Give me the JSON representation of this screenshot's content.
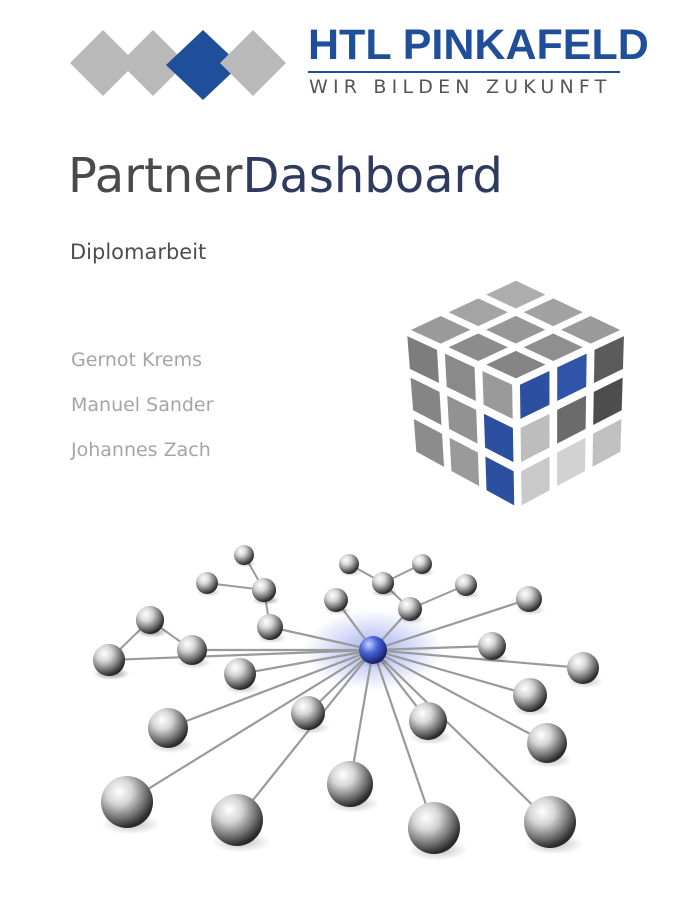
{
  "logo": {
    "name": "HTL PINKAFELD",
    "tagline": "WIR BILDEN ZUKUNFT",
    "brand_color": "#1f4e9a",
    "diamond_color": "#b9b9b9"
  },
  "document": {
    "title_part1": "Partner",
    "title_part2": "Dashboard",
    "subtitle": "Diplomarbeit"
  },
  "authors": [
    "Gernot Krems",
    "Manuel Sander",
    "Johannes Zach"
  ],
  "colors": {
    "title_gray": "#4a4a4a",
    "title_navy": "#2e3a5f",
    "cube_blue": "#2d4f9f",
    "cube_gray": "#8d8d8d",
    "author_gray": "#a5a5a5"
  }
}
